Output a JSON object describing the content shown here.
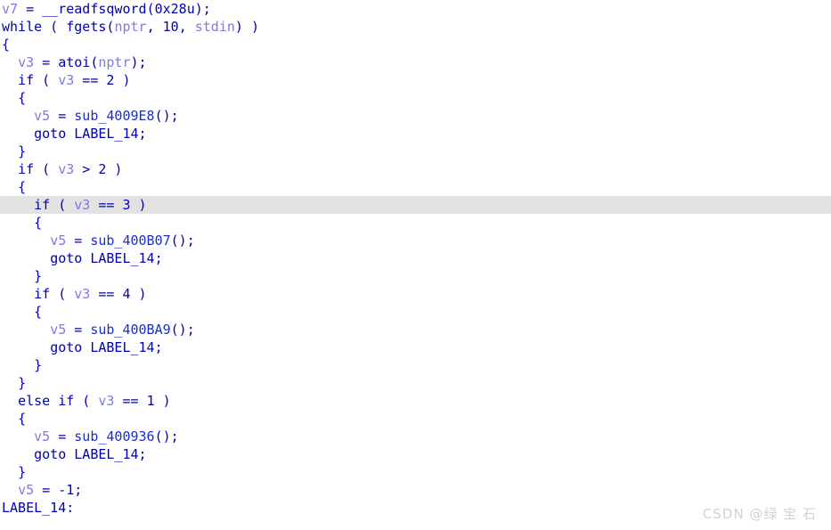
{
  "editor": {
    "name": "decompiler-pseudocode-view",
    "language": "c-pseudocode",
    "highlighted_line_index": 11,
    "horizontal_scroll_clipped": true,
    "colors": {
      "background": "#ffffff",
      "keyword": "#0000b0",
      "function": "#1a2ecc",
      "variable": "#7b7be0",
      "number": "#0000b0",
      "highlight_row": "#e2e2e2",
      "watermark": "#d2d2d2"
    },
    "lines": [
      {
        "indent": 0,
        "highlighted": false,
        "tokens": [
          {
            "t": "var",
            "s": "v7"
          },
          {
            "t": "plain",
            "s": " = "
          },
          {
            "t": "plain",
            "s": "__readfsqword"
          },
          {
            "t": "punct",
            "s": "("
          },
          {
            "t": "num",
            "s": "0x28u"
          },
          {
            "t": "punct",
            "s": ");"
          }
        ]
      },
      {
        "indent": 0,
        "highlighted": false,
        "tokens": [
          {
            "t": "key",
            "s": "while"
          },
          {
            "t": "plain",
            "s": " ( "
          },
          {
            "t": "plain",
            "s": "fgets"
          },
          {
            "t": "punct",
            "s": "("
          },
          {
            "t": "var",
            "s": "nptr"
          },
          {
            "t": "punct",
            "s": ", "
          },
          {
            "t": "num",
            "s": "10"
          },
          {
            "t": "punct",
            "s": ", "
          },
          {
            "t": "var",
            "s": "stdin"
          },
          {
            "t": "punct",
            "s": ") )"
          }
        ]
      },
      {
        "indent": 0,
        "highlighted": false,
        "tokens": [
          {
            "t": "punct",
            "s": "{"
          }
        ]
      },
      {
        "indent": 2,
        "highlighted": false,
        "tokens": [
          {
            "t": "var",
            "s": "v3"
          },
          {
            "t": "plain",
            "s": " = "
          },
          {
            "t": "plain",
            "s": "atoi"
          },
          {
            "t": "punct",
            "s": "("
          },
          {
            "t": "var",
            "s": "nptr"
          },
          {
            "t": "punct",
            "s": ");"
          }
        ]
      },
      {
        "indent": 2,
        "highlighted": false,
        "tokens": [
          {
            "t": "key",
            "s": "if"
          },
          {
            "t": "plain",
            "s": " ( "
          },
          {
            "t": "var",
            "s": "v3"
          },
          {
            "t": "plain",
            "s": " == "
          },
          {
            "t": "num",
            "s": "2"
          },
          {
            "t": "plain",
            "s": " )"
          }
        ]
      },
      {
        "indent": 2,
        "highlighted": false,
        "tokens": [
          {
            "t": "punct",
            "s": "{"
          }
        ]
      },
      {
        "indent": 4,
        "highlighted": false,
        "tokens": [
          {
            "t": "var",
            "s": "v5"
          },
          {
            "t": "plain",
            "s": " = "
          },
          {
            "t": "func",
            "s": "sub_4009E8"
          },
          {
            "t": "punct",
            "s": "();"
          }
        ]
      },
      {
        "indent": 4,
        "highlighted": false,
        "tokens": [
          {
            "t": "key",
            "s": "goto"
          },
          {
            "t": "plain",
            "s": " "
          },
          {
            "t": "label",
            "s": "LABEL_14"
          },
          {
            "t": "punct",
            "s": ";"
          }
        ]
      },
      {
        "indent": 2,
        "highlighted": false,
        "tokens": [
          {
            "t": "punct",
            "s": "}"
          }
        ]
      },
      {
        "indent": 2,
        "highlighted": false,
        "tokens": [
          {
            "t": "key",
            "s": "if"
          },
          {
            "t": "plain",
            "s": " ( "
          },
          {
            "t": "var",
            "s": "v3"
          },
          {
            "t": "plain",
            "s": " > "
          },
          {
            "t": "num",
            "s": "2"
          },
          {
            "t": "plain",
            "s": " )"
          }
        ]
      },
      {
        "indent": 2,
        "highlighted": false,
        "tokens": [
          {
            "t": "punct",
            "s": "{"
          }
        ]
      },
      {
        "indent": 4,
        "highlighted": true,
        "tokens": [
          {
            "t": "key",
            "s": "if"
          },
          {
            "t": "plain",
            "s": " ( "
          },
          {
            "t": "var",
            "s": "v3"
          },
          {
            "t": "plain",
            "s": " == "
          },
          {
            "t": "num",
            "s": "3"
          },
          {
            "t": "plain",
            "s": " )"
          }
        ]
      },
      {
        "indent": 4,
        "highlighted": false,
        "tokens": [
          {
            "t": "punct",
            "s": "{"
          }
        ]
      },
      {
        "indent": 6,
        "highlighted": false,
        "tokens": [
          {
            "t": "var",
            "s": "v5"
          },
          {
            "t": "plain",
            "s": " = "
          },
          {
            "t": "func",
            "s": "sub_400B07"
          },
          {
            "t": "punct",
            "s": "();"
          }
        ]
      },
      {
        "indent": 6,
        "highlighted": false,
        "tokens": [
          {
            "t": "key",
            "s": "goto"
          },
          {
            "t": "plain",
            "s": " "
          },
          {
            "t": "label",
            "s": "LABEL_14"
          },
          {
            "t": "punct",
            "s": ";"
          }
        ]
      },
      {
        "indent": 4,
        "highlighted": false,
        "tokens": [
          {
            "t": "punct",
            "s": "}"
          }
        ]
      },
      {
        "indent": 4,
        "highlighted": false,
        "tokens": [
          {
            "t": "key",
            "s": "if"
          },
          {
            "t": "plain",
            "s": " ( "
          },
          {
            "t": "var",
            "s": "v3"
          },
          {
            "t": "plain",
            "s": " == "
          },
          {
            "t": "num",
            "s": "4"
          },
          {
            "t": "plain",
            "s": " )"
          }
        ]
      },
      {
        "indent": 4,
        "highlighted": false,
        "tokens": [
          {
            "t": "punct",
            "s": "{"
          }
        ]
      },
      {
        "indent": 6,
        "highlighted": false,
        "tokens": [
          {
            "t": "var",
            "s": "v5"
          },
          {
            "t": "plain",
            "s": " = "
          },
          {
            "t": "func",
            "s": "sub_400BA9"
          },
          {
            "t": "punct",
            "s": "();"
          }
        ]
      },
      {
        "indent": 6,
        "highlighted": false,
        "tokens": [
          {
            "t": "key",
            "s": "goto"
          },
          {
            "t": "plain",
            "s": " "
          },
          {
            "t": "label",
            "s": "LABEL_14"
          },
          {
            "t": "punct",
            "s": ";"
          }
        ]
      },
      {
        "indent": 4,
        "highlighted": false,
        "tokens": [
          {
            "t": "punct",
            "s": "}"
          }
        ]
      },
      {
        "indent": 2,
        "highlighted": false,
        "tokens": [
          {
            "t": "punct",
            "s": "}"
          }
        ]
      },
      {
        "indent": 2,
        "highlighted": false,
        "tokens": [
          {
            "t": "key",
            "s": "else"
          },
          {
            "t": "plain",
            "s": " "
          },
          {
            "t": "key",
            "s": "if"
          },
          {
            "t": "plain",
            "s": " ( "
          },
          {
            "t": "var",
            "s": "v3"
          },
          {
            "t": "plain",
            "s": " == "
          },
          {
            "t": "num",
            "s": "1"
          },
          {
            "t": "plain",
            "s": " )"
          }
        ]
      },
      {
        "indent": 2,
        "highlighted": false,
        "tokens": [
          {
            "t": "punct",
            "s": "{"
          }
        ]
      },
      {
        "indent": 4,
        "highlighted": false,
        "tokens": [
          {
            "t": "var",
            "s": "v5"
          },
          {
            "t": "plain",
            "s": " = "
          },
          {
            "t": "func",
            "s": "sub_400936"
          },
          {
            "t": "punct",
            "s": "();"
          }
        ]
      },
      {
        "indent": 4,
        "highlighted": false,
        "tokens": [
          {
            "t": "key",
            "s": "goto"
          },
          {
            "t": "plain",
            "s": " "
          },
          {
            "t": "label",
            "s": "LABEL_14"
          },
          {
            "t": "punct",
            "s": ";"
          }
        ]
      },
      {
        "indent": 2,
        "highlighted": false,
        "tokens": [
          {
            "t": "punct",
            "s": "}"
          }
        ]
      },
      {
        "indent": 2,
        "highlighted": false,
        "tokens": [
          {
            "t": "var",
            "s": "v5"
          },
          {
            "t": "plain",
            "s": " = "
          },
          {
            "t": "num",
            "s": "-1"
          },
          {
            "t": "punct",
            "s": ";"
          }
        ]
      },
      {
        "indent": 0,
        "highlighted": false,
        "tokens": [
          {
            "t": "label",
            "s": "LABEL_14"
          },
          {
            "t": "punct",
            "s": ":"
          }
        ]
      }
    ]
  },
  "watermark": {
    "text": "CSDN @绿 宝 石"
  }
}
